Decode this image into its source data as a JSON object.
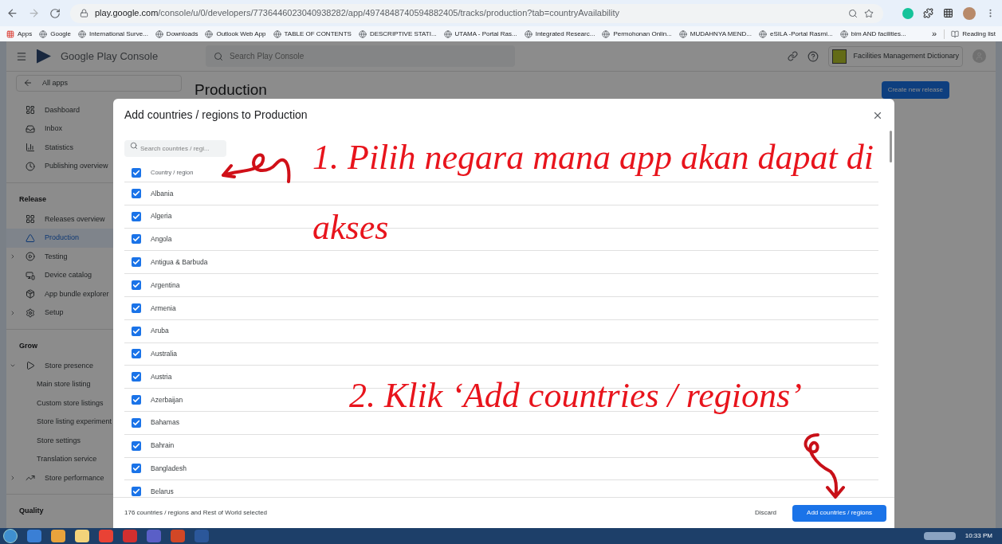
{
  "browser": {
    "url_host": "play.google.com",
    "url_path": "/console/u/0/developers/7736446023040938282/app/4974848740594882405/tracks/production?tab=countryAvailability",
    "bookmarks": [
      {
        "label": "Apps"
      },
      {
        "label": "Google"
      },
      {
        "label": "International Surve..."
      },
      {
        "label": "Downloads"
      },
      {
        "label": "Outlook Web App"
      },
      {
        "label": "TABLE OF CONTENTS"
      },
      {
        "label": "DESCRIPTIVE STATI..."
      },
      {
        "label": "UTAMA - Portal Ras..."
      },
      {
        "label": "Integrated Researc..."
      },
      {
        "label": "Permohonan Onlin..."
      },
      {
        "label": "MUDAHNYA MEND..."
      },
      {
        "label": "eSILA -Portal Rasmi..."
      },
      {
        "label": "bim AND facilities..."
      }
    ],
    "overflow": "»",
    "reading_list": "Reading list"
  },
  "console": {
    "brand": "Google Play Console",
    "search_placeholder": "Search Play Console",
    "app_name": "Facilities Management Dictionary",
    "all_apps": "All apps",
    "page_title": "Production",
    "create_button": "Create new release",
    "nav": [
      {
        "items": [
          {
            "label": "Dashboard",
            "selected": false
          },
          {
            "label": "Inbox",
            "selected": false
          },
          {
            "label": "Statistics",
            "selected": false
          },
          {
            "label": "Publishing overview",
            "selected": false
          }
        ]
      },
      {
        "heading": "Release",
        "items": [
          {
            "label": "Releases overview",
            "selected": false
          },
          {
            "label": "Production",
            "selected": true
          },
          {
            "label": "Testing",
            "selected": false,
            "expanded": false
          },
          {
            "label": "Device catalog",
            "selected": false
          },
          {
            "label": "App bundle explorer",
            "selected": false
          },
          {
            "label": "Setup",
            "selected": false,
            "expanded": false
          }
        ]
      },
      {
        "heading": "Grow",
        "items": [
          {
            "label": "Store presence",
            "selected": false,
            "expanded": true,
            "children": [
              {
                "label": "Main store listing",
                "selected": false
              },
              {
                "label": "Custom store listings",
                "selected": false
              },
              {
                "label": "Store listing experiment",
                "selected": false
              },
              {
                "label": "Store settings",
                "selected": false
              },
              {
                "label": "Translation service",
                "selected": false
              }
            ]
          },
          {
            "label": "Store performance",
            "selected": false,
            "expanded": false
          }
        ]
      },
      {
        "heading": "Quality"
      }
    ]
  },
  "dialog": {
    "title": "Add countries / regions to Production",
    "search_placeholder": "Search countries / regi...",
    "header": {
      "label": "Country / region",
      "checked": true
    },
    "rows": [
      {
        "name": "Albania",
        "checked": true
      },
      {
        "name": "Algeria",
        "checked": true
      },
      {
        "name": "Angola",
        "checked": true
      },
      {
        "name": "Antigua & Barbuda",
        "checked": true
      },
      {
        "name": "Argentina",
        "checked": true
      },
      {
        "name": "Armenia",
        "checked": true
      },
      {
        "name": "Aruba",
        "checked": true
      },
      {
        "name": "Australia",
        "checked": true
      },
      {
        "name": "Austria",
        "checked": true
      },
      {
        "name": "Azerbaijan",
        "checked": true
      },
      {
        "name": "Bahamas",
        "checked": true
      },
      {
        "name": "Bahrain",
        "checked": true
      },
      {
        "name": "Bangladesh",
        "checked": true
      },
      {
        "name": "Belarus",
        "checked": true
      }
    ],
    "summary": "176 countries / regions and Rest of World selected",
    "discard": "Discard",
    "add_button": "Add countries / regions"
  },
  "annotations": [
    {
      "text": "1. Pilih negara mana app akan dapat di akses"
    },
    {
      "text": "2. Klik ‘Add countries / regions’"
    }
  ],
  "taskbar": {
    "time": "10:33 PM"
  }
}
